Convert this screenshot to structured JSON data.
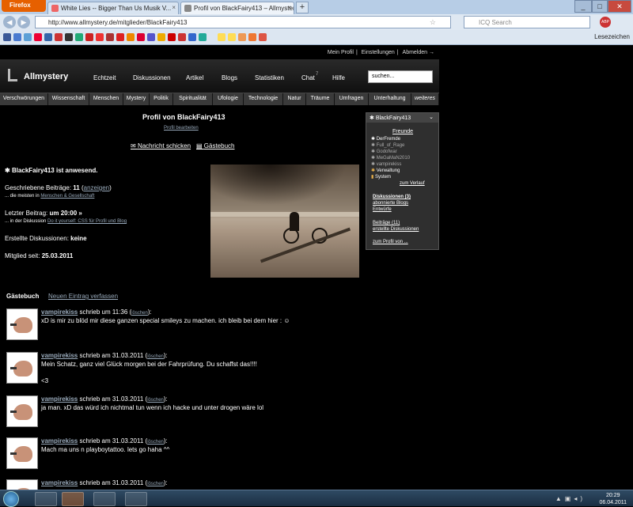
{
  "browser": {
    "app_button": "Firefox",
    "tabs": [
      {
        "title": "White Lies -- Bigger Than Us Musik V...",
        "active": false
      },
      {
        "title": "Profil von BlackFairy413 – Allmystery",
        "active": true
      }
    ],
    "new_tab": "+",
    "url": "http://www.allmystery.de/mitglieder/BlackFairy413",
    "search_placeholder": "ICQ Search",
    "abp": "ABP",
    "bookmarks_label": "Lesezeichen"
  },
  "site": {
    "top_links": [
      "Mein Profil",
      "Einstellungen",
      "Abmelden →"
    ],
    "logo": "Allmystery",
    "nav": [
      "Echtzeit",
      "Diskussionen",
      "Artikel",
      "Blogs",
      "Statistiken",
      "Chat",
      "Hilfe"
    ],
    "chat_count": "7",
    "search_value": "suchen...",
    "categories": [
      "Verschwörungen",
      "Wissenschaft",
      "Menschen",
      "Mystery",
      "Politik",
      "Spiritualität",
      "Ufologie",
      "Technologie",
      "Natur",
      "Träume",
      "Umfragen",
      "Unterhaltung",
      "weiteres"
    ]
  },
  "profile": {
    "title": "Profil von BlackFairy413",
    "edit_link": "Profil bearbeiten",
    "message_link": "Nachricht schicken",
    "guestbook_link": "Gästebuch",
    "present": "BlackFairy413 ist anwesend.",
    "posts_label": "Geschriebene Beiträge:",
    "posts_count": "11",
    "posts_show": "anzeigen",
    "posts_most_prefix": "... die meisten in",
    "posts_most_link": "Menschen & Gesellschaft",
    "last_post_label": "Letzter Beitrag:",
    "last_post_time": "um 20:00 »",
    "last_post_prefix": "... in der Diskussion",
    "last_post_link": "Do it yourself: CSS für Profil und Blog",
    "threads_label": "Erstellte Diskussionen:",
    "threads_value": "keine",
    "member_label": "Mitglied seit:",
    "member_value": "25.03.2011"
  },
  "sidebar": {
    "username": "BlackFairy413",
    "friends_heading": "Freunde",
    "friends": [
      {
        "name": "DerFremde",
        "online": true
      },
      {
        "name": "Full_of_Rage",
        "online": false
      },
      {
        "name": "Godofwar",
        "online": false
      },
      {
        "name": "MeGaMaN2010",
        "online": false
      },
      {
        "name": "vampirekiss",
        "online": false
      },
      {
        "name": "Verwaltung",
        "online": true
      },
      {
        "name": "System",
        "online": true
      }
    ],
    "history_link": "zum Verlauf",
    "discussions": "Diskussionen (3)",
    "blogs": "abonnierte Blogs",
    "drafts": "Entwürfe",
    "posts": "Beiträge (11)",
    "created": "erstellte Diskussionen",
    "profile_of": "zum Profil von ..."
  },
  "guestbook": {
    "heading": "Gästebuch",
    "new_entry": "Neuen Eintrag verfassen",
    "delete_label": "löschen",
    "entries": [
      {
        "author": "vampirekiss",
        "meta": "schrieb um 11:36",
        "text": "xD is mir zu blöd mir diese ganzen special smileys zu machen. ich bleib bei dem hier : ☺",
        "text2": ""
      },
      {
        "author": "vampirekiss",
        "meta": "schrieb am 31.03.2011",
        "text": "Mein Schatz, ganz viel Glück morgen bei der Fahrprüfung. Du schaffst das!!!!",
        "text2": "<3"
      },
      {
        "author": "vampirekiss",
        "meta": "schrieb am 31.03.2011",
        "text": "ja man. xD das würd ich nichtmal tun wenn ich hacke und unter drogen wäre lol",
        "text2": ""
      },
      {
        "author": "vampirekiss",
        "meta": "schrieb am 31.03.2011",
        "text": "Mach ma uns n playboytattoo. lets go haha ^^",
        "text2": ""
      },
      {
        "author": "vampirekiss",
        "meta": "schrieb am 31.03.2011",
        "text": "",
        "text2": ""
      }
    ]
  },
  "taskbar": {
    "time": "20:29",
    "date": "06.04.2011"
  }
}
